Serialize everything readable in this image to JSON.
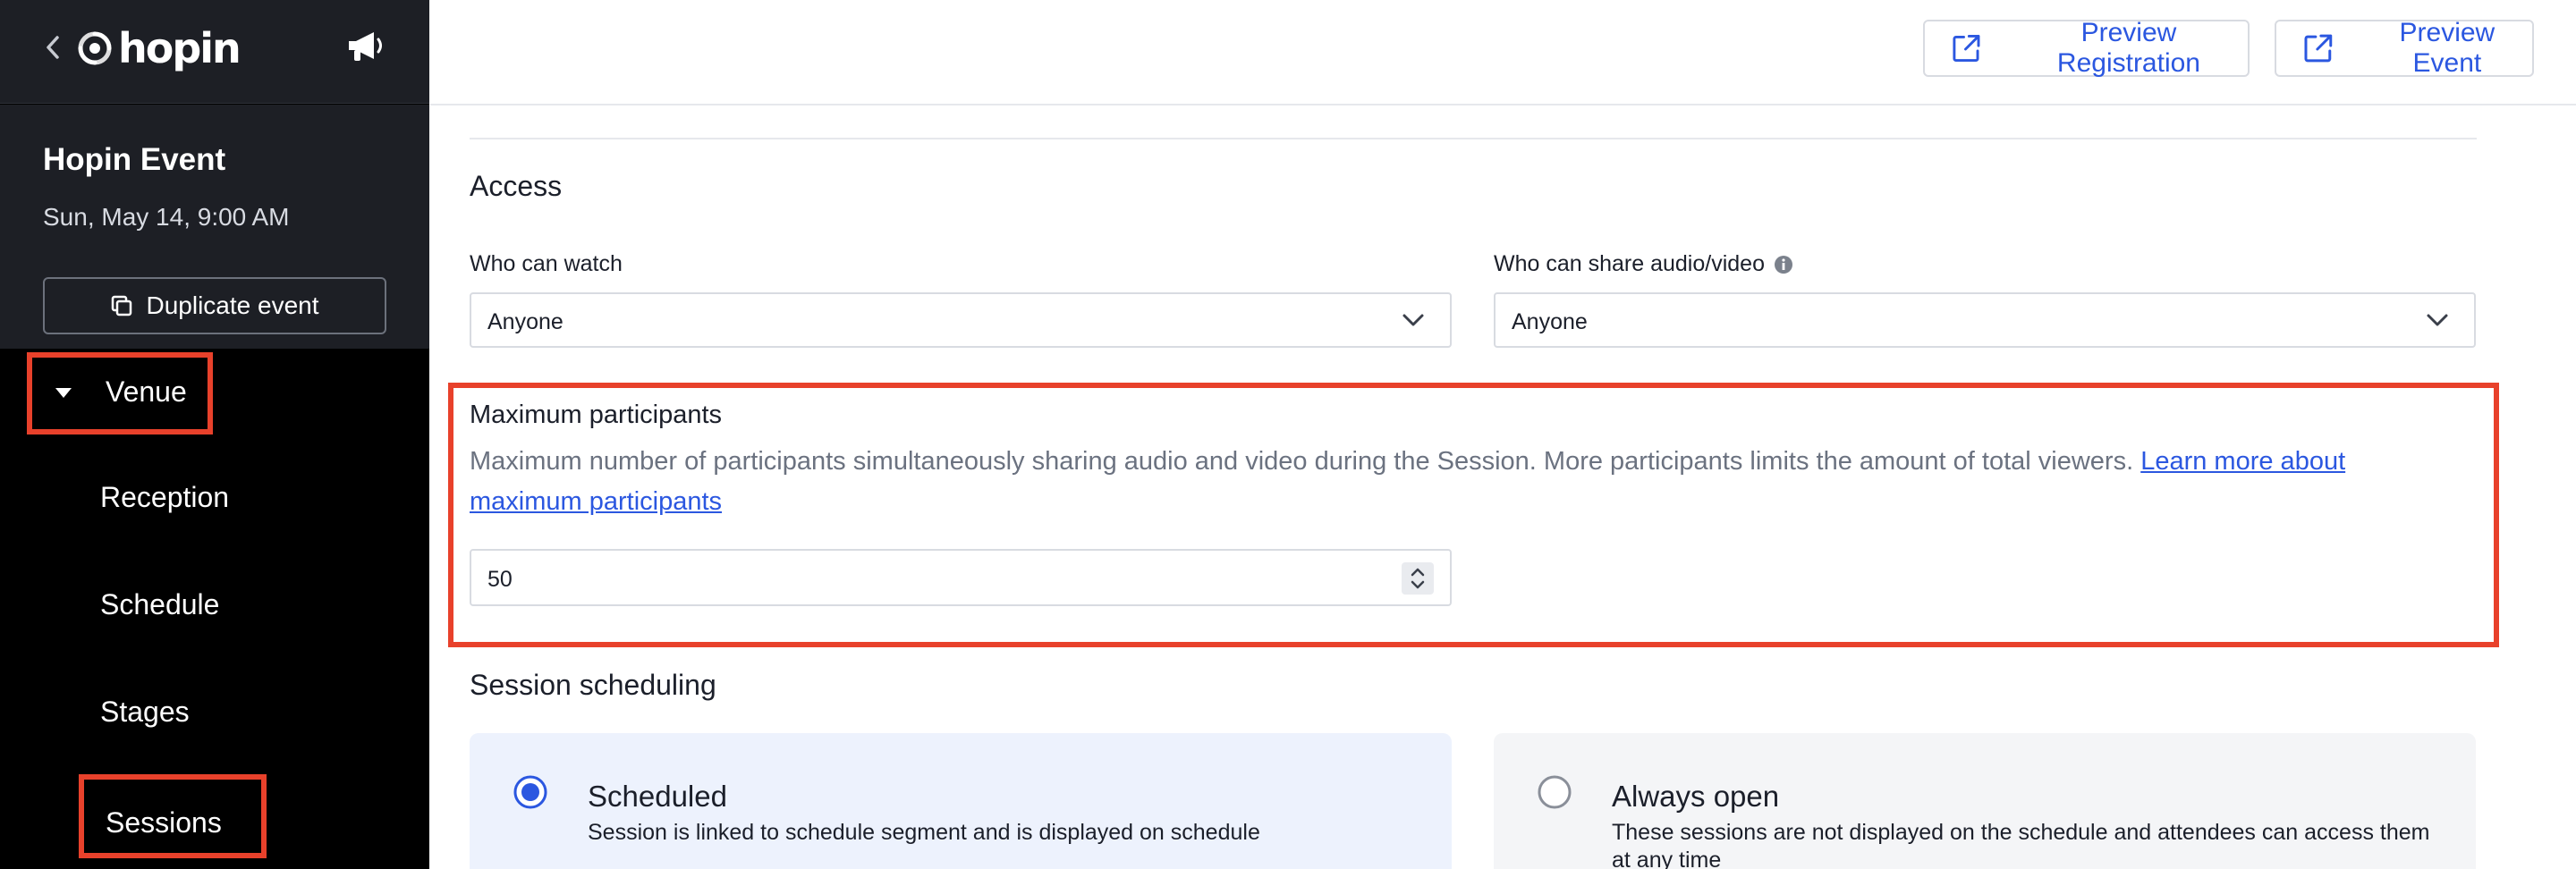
{
  "brand": {
    "name": "hopin"
  },
  "event": {
    "name": "Hopin Event",
    "date": "Sun, May 14, 9:00 AM",
    "duplicate_label": "Duplicate event"
  },
  "sidebar": {
    "venue_label": "Venue",
    "items": [
      {
        "label": "Reception"
      },
      {
        "label": "Schedule"
      },
      {
        "label": "Stages"
      },
      {
        "label": "Sessions"
      }
    ]
  },
  "header": {
    "preview_registration": "Preview Registration",
    "preview_event": "Preview Event"
  },
  "access": {
    "title": "Access",
    "who_can_watch": {
      "label": "Who can watch",
      "value": "Anyone"
    },
    "who_can_share": {
      "label": "Who can share audio/video",
      "value": "Anyone"
    }
  },
  "max_participants": {
    "title": "Maximum participants",
    "description": "Maximum number of participants simultaneously sharing audio and video during the Session. More participants limits the amount of total viewers.",
    "link": "Learn more about maximum participants",
    "value": "50"
  },
  "session_scheduling": {
    "title": "Session scheduling",
    "options": [
      {
        "title": "Scheduled",
        "description": "Session is linked to schedule segment and is displayed on schedule",
        "selected": true
      },
      {
        "title": "Always open",
        "description": "These sessions are not displayed on the schedule and attendees can access them at any time",
        "selected": false
      }
    ]
  },
  "colors": {
    "accent_blue": "#2b57e0",
    "highlight_red": "#e8412b",
    "sidebar_dark": "#1d1f25",
    "selected_card": "#edf2fd"
  }
}
